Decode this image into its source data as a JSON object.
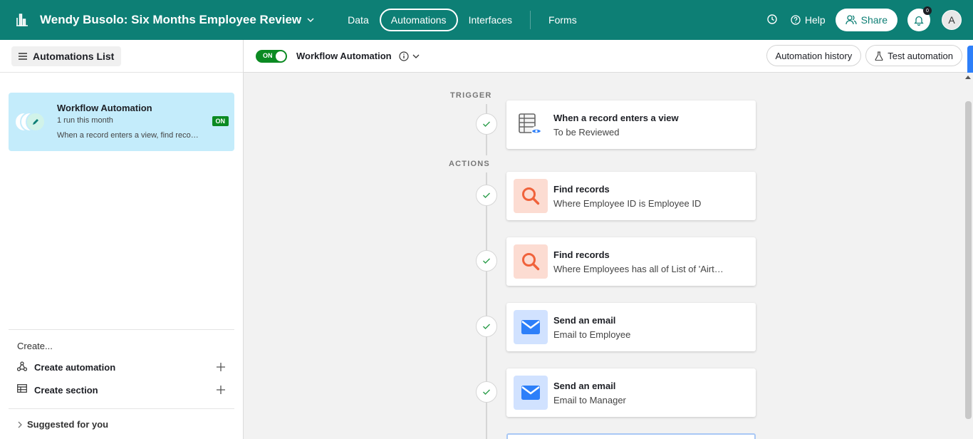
{
  "header": {
    "base_title": "Wendy Busolo: Six Months Employee Review",
    "tabs": [
      {
        "label": "Data",
        "active": false
      },
      {
        "label": "Automations",
        "active": true
      },
      {
        "label": "Interfaces",
        "active": false
      },
      {
        "label": "Forms",
        "active": false
      }
    ],
    "help_label": "Help",
    "share_label": "Share",
    "notification_count": "0",
    "avatar_initial": "A",
    "brand_color": "#0d7f75"
  },
  "sidebar": {
    "list_button": "Automations List",
    "automation": {
      "title": "Workflow Automation",
      "runs": "1 run this month",
      "description": "When a record enters a view, find records, find records, send an email, send an email",
      "status": "ON"
    },
    "create_label": "Create...",
    "create_items": [
      {
        "label": "Create automation",
        "icon": "automation-icon"
      },
      {
        "label": "Create section",
        "icon": "table-icon"
      }
    ],
    "suggested_label": "Suggested for you"
  },
  "main": {
    "toggle_label": "ON",
    "workflow_name": "Workflow Automation",
    "history_button": "Automation history",
    "test_button": "Test automation",
    "trigger_label": "TRIGGER",
    "actions_label": "ACTIONS",
    "trigger": {
      "title": "When a record enters a view",
      "subtitle": "To be Reviewed",
      "icon": "record-view-icon"
    },
    "actions": [
      {
        "title": "Find records",
        "subtitle": "Where Employee ID is Employee ID",
        "icon": "search-icon",
        "color": "#fcdcd2"
      },
      {
        "title": "Find records",
        "subtitle": "Where Employees has all of List of 'Airtable record ID'",
        "icon": "search-icon",
        "color": "#fcdcd2"
      },
      {
        "title": "Send an email",
        "subtitle": "Email to Employee",
        "icon": "mail-icon",
        "color": "#d1e2ff"
      },
      {
        "title": "Send an email",
        "subtitle": "Email to Manager",
        "icon": "mail-icon",
        "color": "#d1e2ff"
      }
    ]
  }
}
